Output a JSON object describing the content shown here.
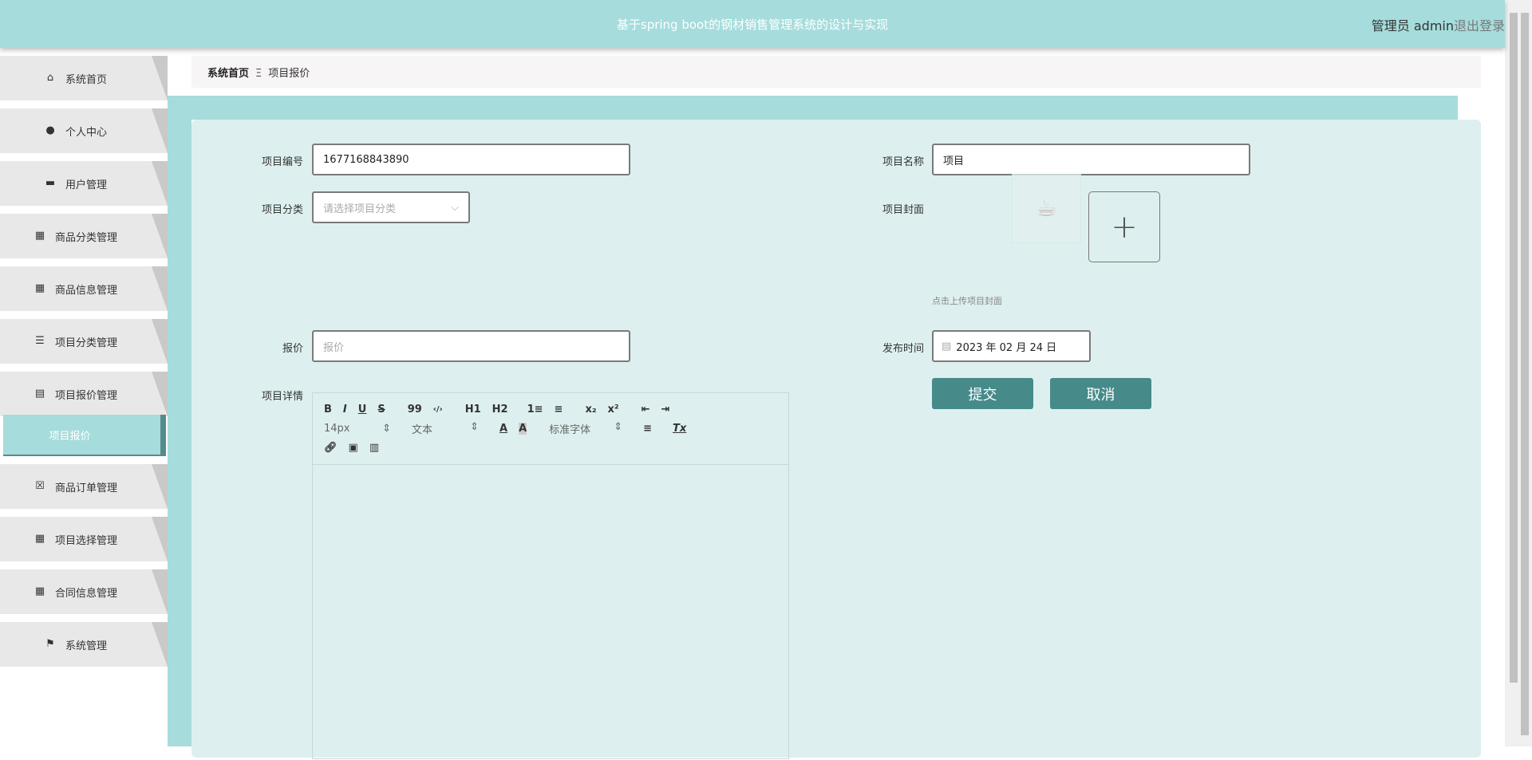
{
  "header": {
    "title": "基于spring boot的钢材销售管理系统的设计与实现",
    "user": "管理员 admin",
    "logout": "退出登录"
  },
  "sidebar": {
    "items": [
      {
        "label": "系统首页",
        "icon": "home-icon"
      },
      {
        "label": "个人中心",
        "icon": "user-icon"
      },
      {
        "label": "用户管理",
        "icon": "monitor-icon"
      },
      {
        "label": "商品分类管理",
        "icon": "grid-icon"
      },
      {
        "label": "商品信息管理",
        "icon": "grid-icon"
      },
      {
        "label": "项目分类管理",
        "icon": "sliders-icon"
      },
      {
        "label": "项目报价管理",
        "icon": "clipboard-icon"
      },
      {
        "label": "项目报价",
        "active": true
      },
      {
        "label": "商品订单管理",
        "icon": "clipboard-x-icon"
      },
      {
        "label": "项目选择管理",
        "icon": "grid-icon"
      },
      {
        "label": "合同信息管理",
        "icon": "grid-icon"
      },
      {
        "label": "系统管理",
        "icon": "flag-icon"
      }
    ]
  },
  "breadcrumb": {
    "home": "系统首页",
    "sep": "Ξ",
    "current": "项目报价"
  },
  "form": {
    "code_label": "项目编号",
    "code_value": "1677168843890",
    "name_label": "项目名称",
    "name_value": "项目",
    "category_label": "项目分类",
    "category_placeholder": "请选择项目分类",
    "cover_label": "项目封面",
    "cover_hint": "点击上传项目封面",
    "price_label": "报价",
    "price_placeholder": "报价",
    "date_label": "发布时间",
    "date_value": "2023 年 02 月 24 日",
    "detail_label": "项目详情",
    "submit": "提交",
    "cancel": "取消"
  },
  "editor": {
    "font_size": "14px",
    "header": "文本",
    "font": "标准字体",
    "buttons": [
      "B",
      "I",
      "U",
      "S",
      "99",
      "‹/›",
      "H1",
      "H2",
      "1≡",
      "≡",
      "x₂",
      "x²",
      "⇤",
      "⇥",
      "A",
      "A",
      "≡",
      "Tx"
    ]
  }
}
